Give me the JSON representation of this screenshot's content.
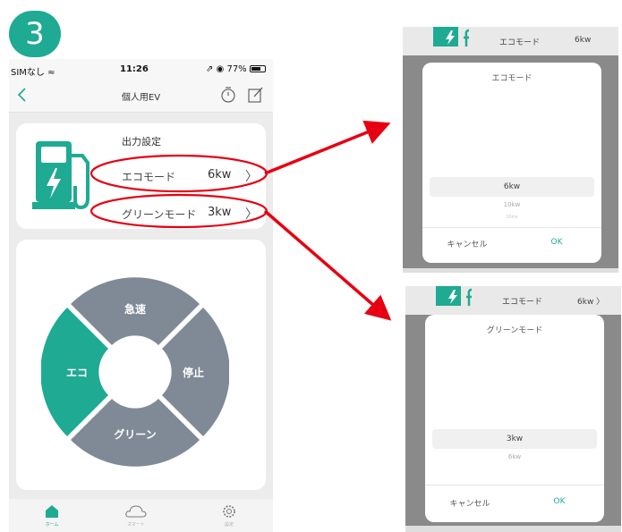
{
  "step_number": "3",
  "status_bar": {
    "carrier": "SIMなし ≈",
    "time": "11:26",
    "battery": "⇗ ◉ 77%"
  },
  "nav": {
    "title": "個人用EV"
  },
  "output_settings": {
    "heading": "出力設定",
    "eco": {
      "label": "エコモード",
      "value": "6kw"
    },
    "green": {
      "label": "グリーンモード",
      "value": "3kw"
    }
  },
  "control_wheel": {
    "rapid": "急速",
    "stop": "停止",
    "green": "グリーン",
    "eco": "エコ"
  },
  "tabs": [
    {
      "label": "ホーム",
      "icon": "home-icon"
    },
    {
      "label": "スマート",
      "icon": "cloud-icon"
    },
    {
      "label": "設定",
      "icon": "gear-icon"
    }
  ],
  "popup_eco": {
    "bg_mode": "エコモード",
    "bg_value": "6kw",
    "title": "エコモード",
    "options": [
      "6kw",
      "10kw",
      "16kw"
    ],
    "cancel": "キャンセル",
    "ok": "OK"
  },
  "popup_green": {
    "bg_mode": "エコモード",
    "bg_value": "6kw 〉",
    "title": "グリーンモード",
    "options": [
      "3kw",
      "6kw"
    ],
    "cancel": "キャンセル",
    "ok": "OK"
  },
  "colors": {
    "accent": "#1eaa93",
    "wheel_gray": "#7f8a96",
    "annotation_red": "#e60012"
  }
}
